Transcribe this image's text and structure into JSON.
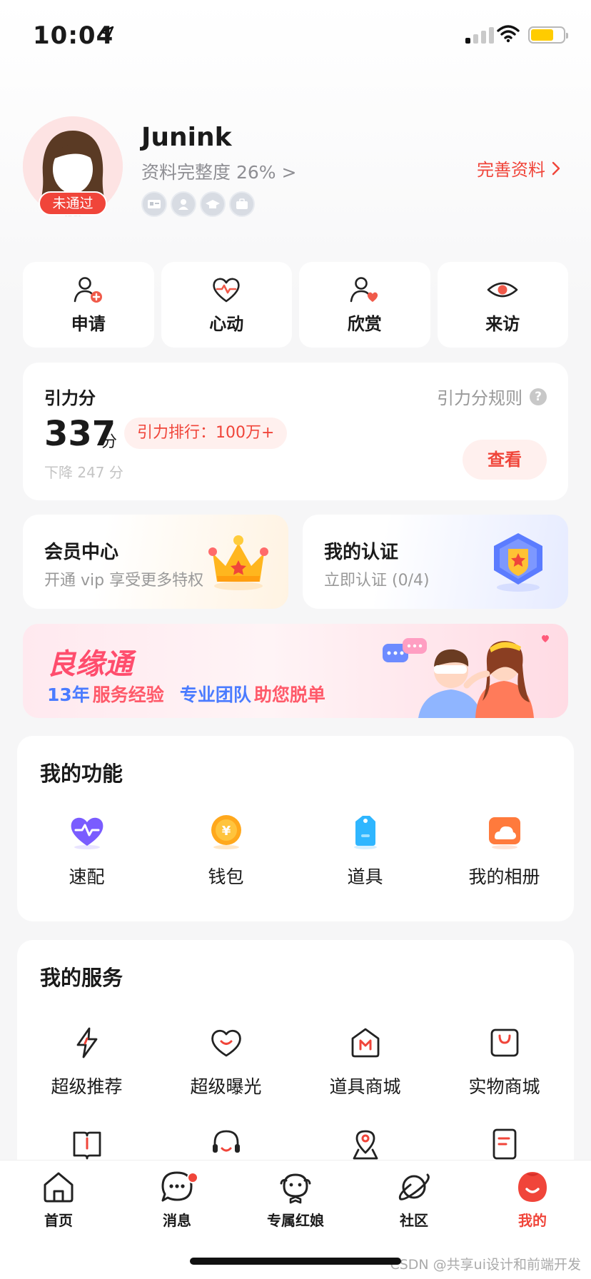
{
  "status_bar": {
    "time": "10:04"
  },
  "profile": {
    "name": "Junink",
    "progress_text": "资料完整度 26% >",
    "review_badge": "未通过",
    "improve_link": "完善资料"
  },
  "quick_actions": [
    {
      "label": "申请",
      "icon": "user-add-icon"
    },
    {
      "label": "心动",
      "icon": "heartbeat-icon"
    },
    {
      "label": "欣赏",
      "icon": "user-heart-icon"
    },
    {
      "label": "来访",
      "icon": "eye-icon"
    }
  ],
  "score": {
    "title": "引力分",
    "rules_link": "引力分规则",
    "value": "337",
    "unit": "分",
    "rank": "引力排行：100万+",
    "change": "下降 247 分",
    "view_button": "查看"
  },
  "member": {
    "title": "会员中心",
    "subtitle": "开通 vip 享受更多特权",
    "icon": "crown-icon"
  },
  "verify": {
    "title": "我的认证",
    "subtitle": "立即认证 (0/4)",
    "icon": "shield-star-icon"
  },
  "banner": {
    "title": "良缘通",
    "sub_part1": "13年",
    "sub_part2": "服务经验",
    "sub_part3": "专业团队",
    "sub_part4": "助您脱单"
  },
  "functions": {
    "title": "我的功能",
    "items": [
      {
        "label": "速配",
        "icon": "pulse-heart-icon"
      },
      {
        "label": "钱包",
        "icon": "coin-icon"
      },
      {
        "label": "道具",
        "icon": "tag-icon"
      },
      {
        "label": "我的相册",
        "icon": "album-icon"
      }
    ]
  },
  "services": {
    "title": "我的服务",
    "items": [
      {
        "label": "超级推荐",
        "icon": "lightning-icon"
      },
      {
        "label": "超级曝光",
        "icon": "smile-heart-icon"
      },
      {
        "label": "道具商城",
        "icon": "m-store-icon"
      },
      {
        "label": "实物商城",
        "icon": "shopping-bag-icon"
      }
    ],
    "items_row2": [
      {
        "icon": "book-icon"
      },
      {
        "icon": "headset-icon"
      },
      {
        "icon": "location-icon"
      },
      {
        "icon": "document-icon"
      }
    ]
  },
  "tabs": [
    {
      "label": "首页",
      "icon": "home-icon"
    },
    {
      "label": "消息",
      "icon": "chat-icon"
    },
    {
      "label": "专属红娘",
      "icon": "matchmaker-icon"
    },
    {
      "label": "社区",
      "icon": "planet-icon"
    },
    {
      "label": "我的",
      "icon": "me-icon"
    }
  ],
  "watermark": "CSDN @共享ui设计和前端开发",
  "colors": {
    "accent": "#f0453a",
    "background": "#f6f6f7"
  }
}
